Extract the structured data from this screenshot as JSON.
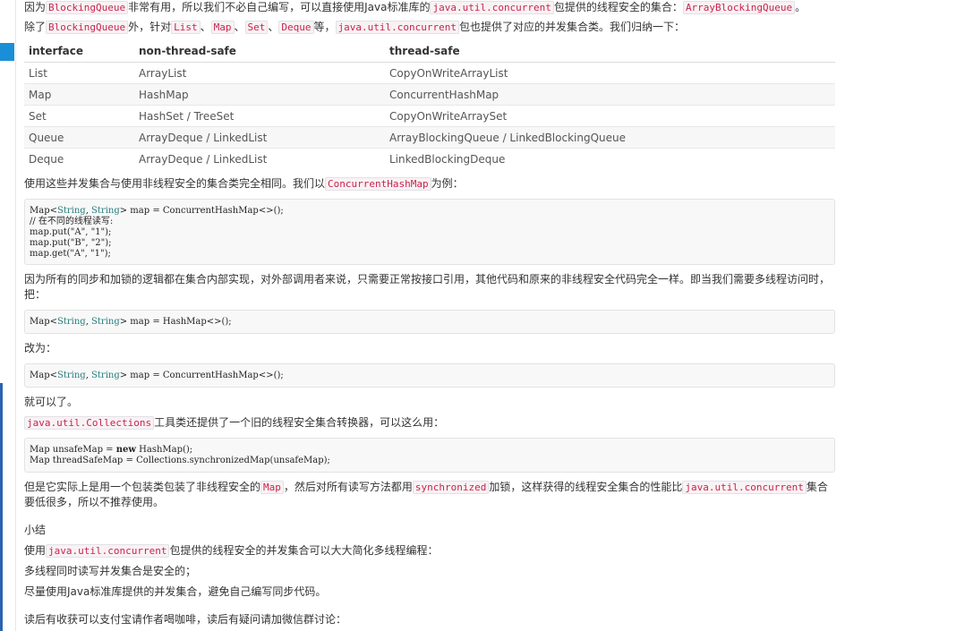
{
  "intro": {
    "p1_a": "因为",
    "p1_code1": "BlockingQueue",
    "p1_b": "非常有用，所以我们不必自己编写，可以直接使用Java标准库的",
    "p1_code2": "java.util.concurrent",
    "p1_c": "包提供的线程安全的集合：",
    "p1_code3": "ArrayBlockingQueue",
    "p1_d": "。",
    "p2_a": "除了",
    "p2_code1": "BlockingQueue",
    "p2_b": "外，针对",
    "p2_code2": "List",
    "p2_sep1": "、",
    "p2_code3": "Map",
    "p2_sep2": "、",
    "p2_code4": "Set",
    "p2_sep3": "、",
    "p2_code5": "Deque",
    "p2_c": "等，",
    "p2_code6": "java.util.concurrent",
    "p2_d": "包也提供了对应的并发集合类。我们归纳一下："
  },
  "table": {
    "headers": [
      "interface",
      "non-thread-safe",
      "thread-safe"
    ],
    "rows": [
      [
        "List",
        "ArrayList",
        "CopyOnWriteArrayList"
      ],
      [
        "Map",
        "HashMap",
        "ConcurrentHashMap"
      ],
      [
        "Set",
        "HashSet / TreeSet",
        "CopyOnWriteArraySet"
      ],
      [
        "Queue",
        "ArrayDeque / LinkedList",
        "ArrayBlockingQueue / LinkedBlockingQueue"
      ],
      [
        "Deque",
        "ArrayDeque / LinkedList",
        "LinkedBlockingDeque"
      ]
    ]
  },
  "usage": {
    "a": "使用这些并发集合与使用非线程安全的集合类完全相同。我们以",
    "code": "ConcurrentHashMap",
    "b": "为例："
  },
  "code1": {
    "l1_a": "Map<",
    "l1_t1": "String",
    "l1_comma": ", ",
    "l1_t2": "String",
    "l1_b": "> map = ConcurrentHashMap<>();",
    "l2": "// 在不同的线程读写:",
    "l3": "map.put(\"A\", \"1\");",
    "l4": "map.put(\"B\", \"2\");",
    "l5": "map.get(\"A\", \"1\");"
  },
  "explain": "因为所有的同步和加锁的逻辑都在集合内部实现，对外部调用者来说，只需要正常按接口引用，其他代码和原来的非线程安全代码完全一样。即当我们需要多线程访问时，把：",
  "code2": {
    "a": "Map<",
    "t1": "String",
    "comma": ", ",
    "t2": "String",
    "b": "> map = HashMap<>();"
  },
  "change_to": "改为：",
  "code3": {
    "a": "Map<",
    "t1": "String",
    "comma": ", ",
    "t2": "String",
    "b": "> map = ConcurrentHashMap<>();"
  },
  "done": "就可以了。",
  "collections": {
    "code": "java.util.Collections",
    "text": "工具类还提供了一个旧的线程安全集合转换器，可以这么用："
  },
  "code4": {
    "l1_a": "Map unsafeMap = ",
    "l1_kw": "new",
    "l1_b": " HashMap();",
    "l2": "Map threadSafeMap = Collections.synchronizedMap(unsafeMap);"
  },
  "wrapper": {
    "a": "但是它实际上是用一个包装类包装了非线程安全的",
    "code1": "Map",
    "b": "，然后对所有读写方法都用",
    "code2": "synchronized",
    "c": "加锁，这样获得的线程安全集合的性能比",
    "code3": "java.util.concurrent",
    "d": "集合要低很多，所以不推荐使用。"
  },
  "summary": {
    "title": "小结",
    "l1_a": "使用",
    "l1_code": "java.util.concurrent",
    "l1_b": "包提供的线程安全的并发集合可以大大简化多线程编程：",
    "l2": "多线程同时读写并发集合是安全的；",
    "l3": "尽量使用Java标准库提供的并发集合，避免自己编写同步代码。"
  },
  "footer": "读后有收获可以支付宝请作者喝咖啡，读后有疑问请加微信群讨论："
}
